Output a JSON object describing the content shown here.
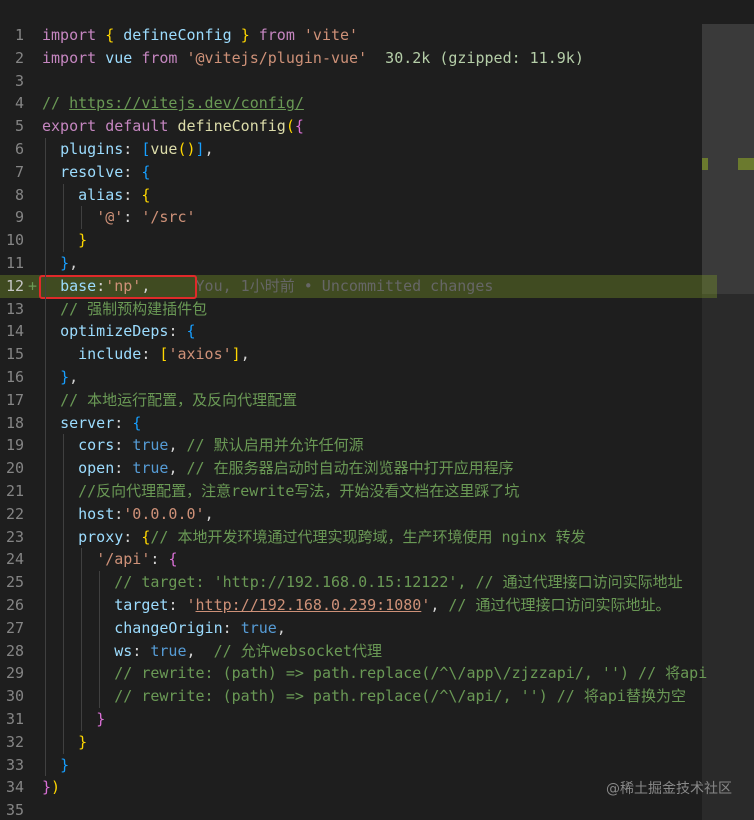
{
  "editor": {
    "highlighted_line_number": "12",
    "diff_marker": "+",
    "lines": [
      {
        "n": "1",
        "tokens": [
          {
            "t": "import",
            "c": "kw2"
          },
          {
            "t": " "
          },
          {
            "t": "{",
            "c": "br1"
          },
          {
            "t": " defineConfig ",
            "c": "prop"
          },
          {
            "t": "}",
            "c": "br1"
          },
          {
            "t": " "
          },
          {
            "t": "from",
            "c": "kw2"
          },
          {
            "t": " "
          },
          {
            "t": "'vite'",
            "c": "str"
          }
        ]
      },
      {
        "n": "2",
        "tokens": [
          {
            "t": "import",
            "c": "kw2"
          },
          {
            "t": " "
          },
          {
            "t": "vue",
            "c": "prop"
          },
          {
            "t": " "
          },
          {
            "t": "from",
            "c": "kw2"
          },
          {
            "t": " "
          },
          {
            "t": "'@vitejs/plugin-vue'",
            "c": "str"
          },
          {
            "t": "  30.2k (gzipped: 11.9k)",
            "c": "pkgsize"
          }
        ]
      },
      {
        "n": "3",
        "tokens": []
      },
      {
        "n": "4",
        "tokens": [
          {
            "t": "// ",
            "c": "cmt"
          },
          {
            "t": "https://vitejs.dev/config/",
            "c": "cmt link"
          }
        ]
      },
      {
        "n": "5",
        "tokens": [
          {
            "t": "export",
            "c": "kw2"
          },
          {
            "t": " "
          },
          {
            "t": "default",
            "c": "kw2"
          },
          {
            "t": " "
          },
          {
            "t": "defineConfig",
            "c": "fn"
          },
          {
            "t": "(",
            "c": "br1"
          },
          {
            "t": "{",
            "c": "br2"
          }
        ]
      },
      {
        "n": "6",
        "tokens": [
          {
            "t": "  "
          },
          {
            "t": "plugins",
            "c": "prop"
          },
          {
            "t": ": "
          },
          {
            "t": "[",
            "c": "br3"
          },
          {
            "t": "vue",
            "c": "fn"
          },
          {
            "t": "()",
            "c": "br1"
          },
          {
            "t": "]",
            "c": "br3"
          },
          {
            "t": ","
          }
        ]
      },
      {
        "n": "7",
        "tokens": [
          {
            "t": "  "
          },
          {
            "t": "resolve",
            "c": "prop"
          },
          {
            "t": ": "
          },
          {
            "t": "{",
            "c": "br3"
          }
        ]
      },
      {
        "n": "8",
        "tokens": [
          {
            "t": "    "
          },
          {
            "t": "alias",
            "c": "prop"
          },
          {
            "t": ": "
          },
          {
            "t": "{",
            "c": "br1"
          }
        ]
      },
      {
        "n": "9",
        "tokens": [
          {
            "t": "      "
          },
          {
            "t": "'@'",
            "c": "str"
          },
          {
            "t": ": "
          },
          {
            "t": "'/src'",
            "c": "str"
          }
        ]
      },
      {
        "n": "10",
        "tokens": [
          {
            "t": "    "
          },
          {
            "t": "}",
            "c": "br1"
          }
        ]
      },
      {
        "n": "11",
        "tokens": [
          {
            "t": "  "
          },
          {
            "t": "}",
            "c": "br3"
          },
          {
            "t": ","
          }
        ]
      },
      {
        "n": "12",
        "tokens": [
          {
            "t": "  "
          },
          {
            "t": "base",
            "c": "prop"
          },
          {
            "t": ":"
          },
          {
            "t": "'np'",
            "c": "str"
          },
          {
            "t": ",     "
          },
          {
            "t": "You, 1小时前 • Uncommitted changes",
            "c": "inline-blame"
          }
        ]
      },
      {
        "n": "13",
        "tokens": [
          {
            "t": "  "
          },
          {
            "t": "// 强制预构建插件包",
            "c": "cmt"
          }
        ]
      },
      {
        "n": "14",
        "tokens": [
          {
            "t": "  "
          },
          {
            "t": "optimizeDeps",
            "c": "prop"
          },
          {
            "t": ": "
          },
          {
            "t": "{",
            "c": "br3"
          }
        ]
      },
      {
        "n": "15",
        "tokens": [
          {
            "t": "    "
          },
          {
            "t": "include",
            "c": "prop"
          },
          {
            "t": ": "
          },
          {
            "t": "[",
            "c": "br1"
          },
          {
            "t": "'axios'",
            "c": "str"
          },
          {
            "t": "]",
            "c": "br1"
          },
          {
            "t": ","
          }
        ]
      },
      {
        "n": "16",
        "tokens": [
          {
            "t": "  "
          },
          {
            "t": "}",
            "c": "br3"
          },
          {
            "t": ","
          }
        ]
      },
      {
        "n": "17",
        "tokens": [
          {
            "t": "  "
          },
          {
            "t": "// 本地运行配置，及反向代理配置",
            "c": "cmt"
          }
        ]
      },
      {
        "n": "18",
        "tokens": [
          {
            "t": "  "
          },
          {
            "t": "server",
            "c": "prop"
          },
          {
            "t": ": "
          },
          {
            "t": "{",
            "c": "br3"
          }
        ]
      },
      {
        "n": "19",
        "tokens": [
          {
            "t": "    "
          },
          {
            "t": "cors",
            "c": "prop"
          },
          {
            "t": ": "
          },
          {
            "t": "true",
            "c": "kw"
          },
          {
            "t": ", "
          },
          {
            "t": "// 默认启用并允许任何源",
            "c": "cmt"
          }
        ]
      },
      {
        "n": "20",
        "tokens": [
          {
            "t": "    "
          },
          {
            "t": "open",
            "c": "prop"
          },
          {
            "t": ": "
          },
          {
            "t": "true",
            "c": "kw"
          },
          {
            "t": ", "
          },
          {
            "t": "// 在服务器启动时自动在浏览器中打开应用程序",
            "c": "cmt"
          }
        ]
      },
      {
        "n": "21",
        "tokens": [
          {
            "t": "    "
          },
          {
            "t": "//反向代理配置，注意rewrite写法，开始没看文档在这里踩了坑",
            "c": "cmt"
          }
        ]
      },
      {
        "n": "22",
        "tokens": [
          {
            "t": "    "
          },
          {
            "t": "host",
            "c": "prop"
          },
          {
            "t": ":"
          },
          {
            "t": "'0.0.0.0'",
            "c": "str"
          },
          {
            "t": ","
          }
        ]
      },
      {
        "n": "23",
        "tokens": [
          {
            "t": "    "
          },
          {
            "t": "proxy",
            "c": "prop"
          },
          {
            "t": ": "
          },
          {
            "t": "{",
            "c": "br1"
          },
          {
            "t": "// 本地开发环境通过代理实现跨域，生产环境使用 nginx 转发",
            "c": "cmt"
          }
        ]
      },
      {
        "n": "24",
        "tokens": [
          {
            "t": "      "
          },
          {
            "t": "'/api'",
            "c": "str"
          },
          {
            "t": ": "
          },
          {
            "t": "{",
            "c": "br2"
          }
        ]
      },
      {
        "n": "25",
        "tokens": [
          {
            "t": "        "
          },
          {
            "t": "// target: 'http://192.168.0.15:12122', // 通过代理接口访问实际地址",
            "c": "cmt"
          }
        ]
      },
      {
        "n": "26",
        "tokens": [
          {
            "t": "        "
          },
          {
            "t": "target",
            "c": "prop"
          },
          {
            "t": ": "
          },
          {
            "t": "'",
            "c": "str"
          },
          {
            "t": "http://192.168.0.239:1080",
            "c": "str link"
          },
          {
            "t": "'",
            "c": "str"
          },
          {
            "t": ", "
          },
          {
            "t": "// 通过代理接口访问实际地址。",
            "c": "cmt"
          }
        ]
      },
      {
        "n": "27",
        "tokens": [
          {
            "t": "        "
          },
          {
            "t": "changeOrigin",
            "c": "prop"
          },
          {
            "t": ": "
          },
          {
            "t": "true",
            "c": "kw"
          },
          {
            "t": ","
          }
        ]
      },
      {
        "n": "28",
        "tokens": [
          {
            "t": "        "
          },
          {
            "t": "ws",
            "c": "prop"
          },
          {
            "t": ": "
          },
          {
            "t": "true",
            "c": "kw"
          },
          {
            "t": ",  "
          },
          {
            "t": "// 允许websocket代理",
            "c": "cmt"
          }
        ]
      },
      {
        "n": "29",
        "tokens": [
          {
            "t": "        "
          },
          {
            "t": "// rewrite: (path) => path.replace(/^\\/app\\/zjzzapi/, '') // 将api",
            "c": "cmt"
          }
        ]
      },
      {
        "n": "30",
        "tokens": [
          {
            "t": "        "
          },
          {
            "t": "// rewrite: (path) => path.replace(/^\\/api/, '') // 将api替换为空",
            "c": "cmt"
          }
        ]
      },
      {
        "n": "31",
        "tokens": [
          {
            "t": "      "
          },
          {
            "t": "}",
            "c": "br2"
          }
        ]
      },
      {
        "n": "32",
        "tokens": [
          {
            "t": "    "
          },
          {
            "t": "}",
            "c": "br1"
          }
        ]
      },
      {
        "n": "33",
        "tokens": [
          {
            "t": "  "
          },
          {
            "t": "}",
            "c": "br3"
          }
        ]
      },
      {
        "n": "34",
        "tokens": [
          {
            "t": "}",
            "c": "br2"
          },
          {
            "t": ")",
            "c": "br1"
          }
        ]
      },
      {
        "n": "35",
        "tokens": []
      }
    ]
  },
  "watermark": "@稀土掘金技术社区",
  "colors": {
    "background": "#1e1e1e",
    "highlight": "#6b7a2e",
    "annotation_box": "#e02a2a"
  }
}
